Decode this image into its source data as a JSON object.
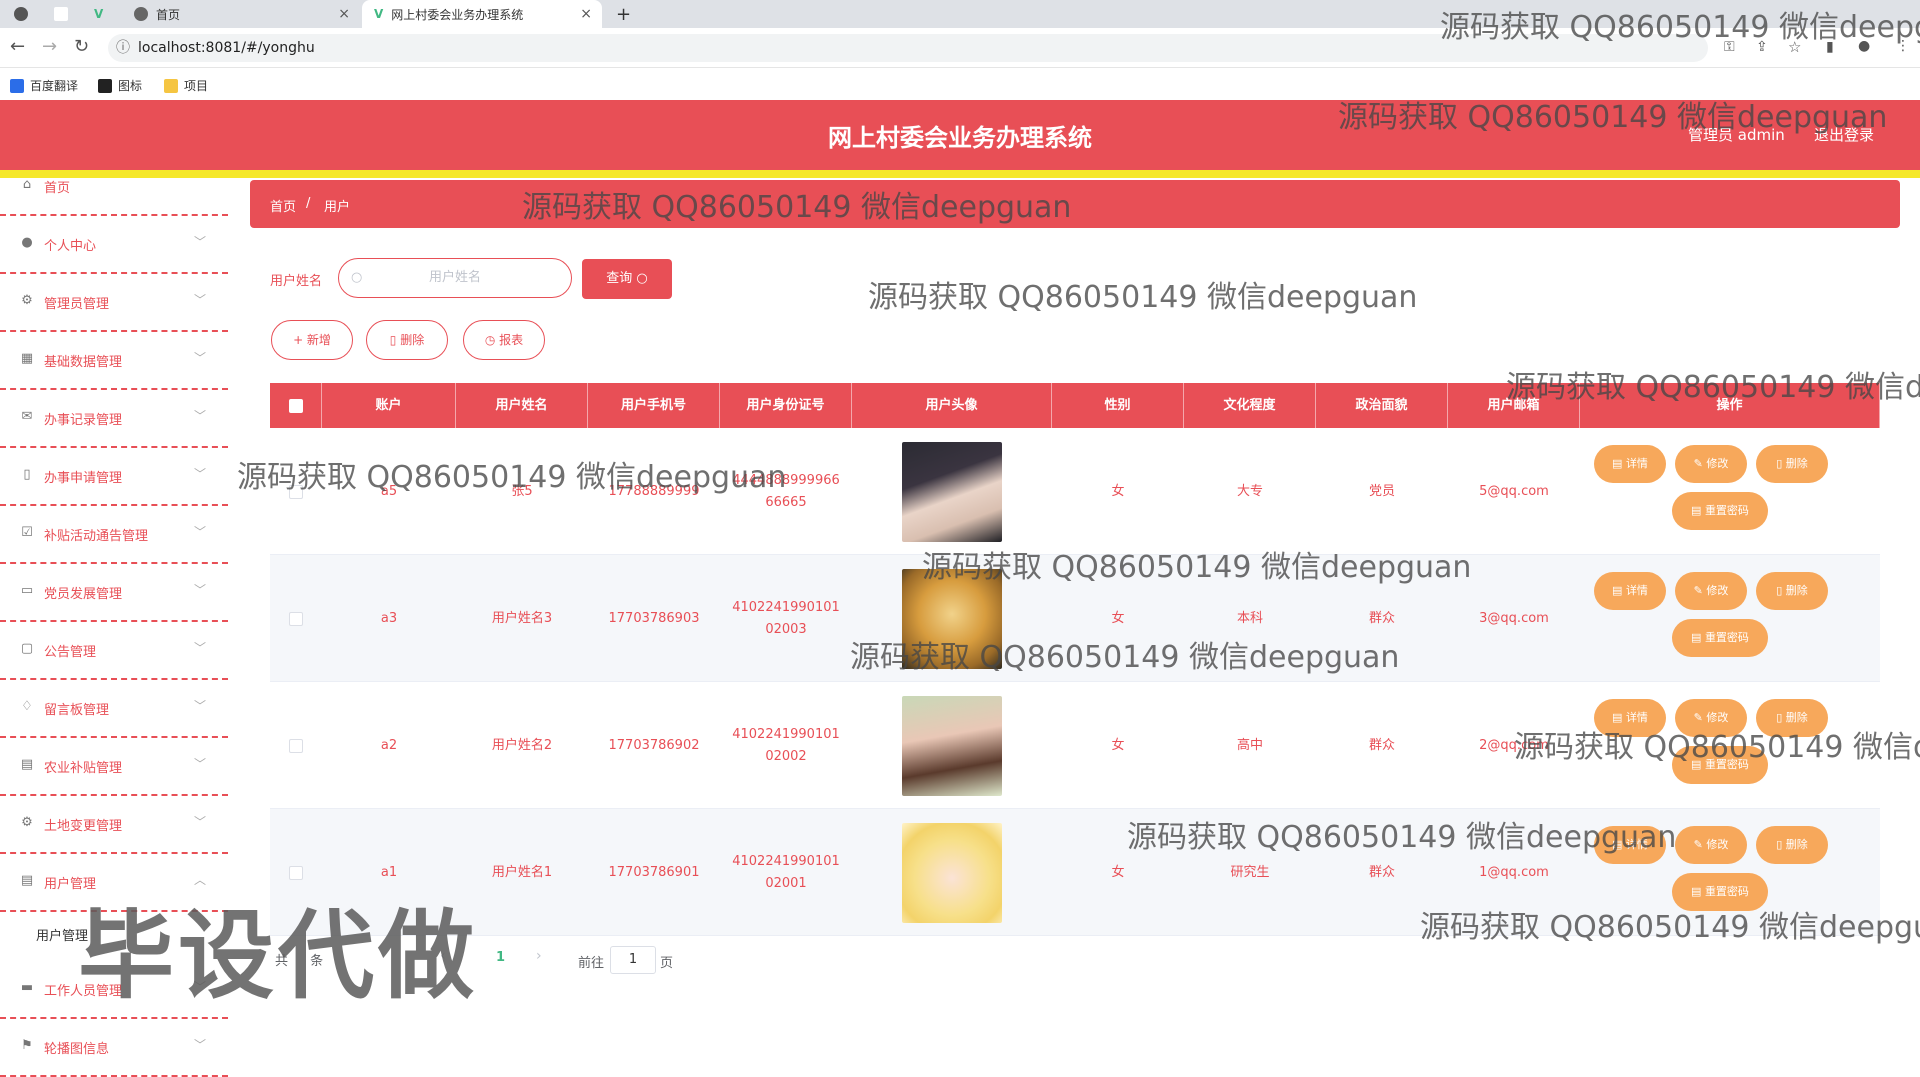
{
  "browser": {
    "tabs": [
      {
        "label": "首页",
        "active": false
      },
      {
        "label": "网上村委会业务办理系统",
        "active": true
      }
    ],
    "url": "localhost:8081/#/yonghu",
    "bookmarks": [
      "百度翻译",
      "图标",
      "项目"
    ]
  },
  "header": {
    "title": "网上村委会业务办理系统",
    "admin_label": "管理员 admin",
    "logout_label": "退出登录"
  },
  "sidebar": {
    "items": [
      {
        "label": "首页",
        "icon": "home-icon"
      },
      {
        "label": "个人中心",
        "icon": "user-icon"
      },
      {
        "label": "管理员管理",
        "icon": "settings-icon"
      },
      {
        "label": "基础数据管理",
        "icon": "grid-icon"
      },
      {
        "label": "办事记录管理",
        "icon": "mail-icon"
      },
      {
        "label": "办事申请管理",
        "icon": "phone-icon"
      },
      {
        "label": "补贴活动通告管理",
        "icon": "check-icon"
      },
      {
        "label": "党员发展管理",
        "icon": "monitor-icon"
      },
      {
        "label": "公告管理",
        "icon": "chat-icon"
      },
      {
        "label": "留言板管理",
        "icon": "bell-icon"
      },
      {
        "label": "农业补贴管理",
        "icon": "clipboard-icon"
      },
      {
        "label": "土地变更管理",
        "icon": "settings-icon"
      },
      {
        "label": "用户管理",
        "icon": "clipboard-icon"
      },
      {
        "label": "工作人员管理",
        "icon": "ticket-icon"
      },
      {
        "label": "轮播图信息",
        "icon": "flag-icon"
      }
    ],
    "submenu_label": "用户管理"
  },
  "breadcrumb": {
    "home": "首页",
    "current": "用户"
  },
  "search": {
    "label": "用户姓名",
    "placeholder": "用户姓名",
    "button_label": "查询"
  },
  "actions": {
    "add_label": "+ 新增",
    "delete_label": "删除",
    "report_label": "报表"
  },
  "table": {
    "columns": [
      "账户",
      "用户姓名",
      "用户手机号",
      "用户身份证号",
      "用户头像",
      "性别",
      "文化程度",
      "政治面貌",
      "用户邮箱",
      "操作"
    ],
    "rows": [
      {
        "account": "a5",
        "name": "张5",
        "phone": "17788889999",
        "id_card": "444488899996666665",
        "gender": "女",
        "education": "大专",
        "political": "党员",
        "email": "5@qq.com",
        "avatar": "woman-portrait"
      },
      {
        "account": "a3",
        "name": "用户姓名3",
        "phone": "17703786903",
        "id_card": "410224199010102003",
        "gender": "女",
        "education": "本科",
        "political": "群众",
        "email": "3@qq.com",
        "avatar": "puppy"
      },
      {
        "account": "a2",
        "name": "用户姓名2",
        "phone": "17703786902",
        "id_card": "410224199010102002",
        "gender": "女",
        "education": "高中",
        "political": "群众",
        "email": "2@qq.com",
        "avatar": "woman-smiling"
      },
      {
        "account": "a1",
        "name": "用户姓名1",
        "phone": "17703786901",
        "id_card": "410224199010102001",
        "gender": "女",
        "education": "研究生",
        "political": "群众",
        "email": "1@qq.com",
        "avatar": "anime-girl"
      }
    ],
    "op_labels": {
      "detail": "详情",
      "edit": "修改",
      "delete": "删除",
      "reset": "重置密码"
    }
  },
  "pagination": {
    "total_prefix": "共",
    "total_suffix": "条",
    "current_page": "1",
    "goto_label": "前往",
    "page_input": "1",
    "page_suffix": "页"
  },
  "watermarks": {
    "text": "源码获取 QQ86050149 微信deepguan",
    "big": "毕设代做"
  },
  "colors": {
    "primary": "#e84f56",
    "accent_line": "#f5e82a",
    "op_button": "#f7a85b"
  }
}
